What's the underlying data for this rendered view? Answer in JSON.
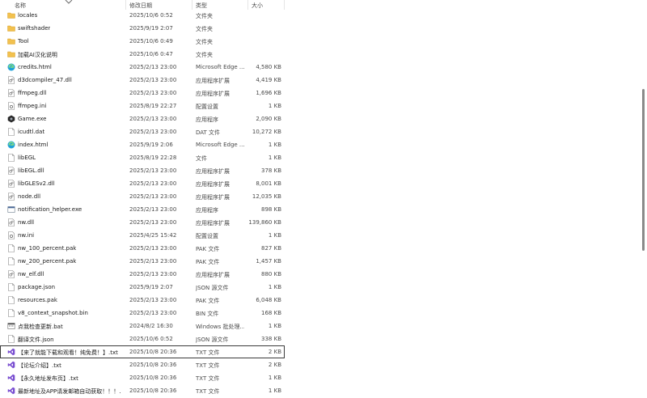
{
  "header": {
    "name": "名称",
    "date": "修改日期",
    "type": "类型",
    "size": "大小"
  },
  "files": [
    {
      "name": "locales",
      "date": "2025/10/6 0:52",
      "type": "文件夹",
      "size": "",
      "icon": "folder-icon"
    },
    {
      "name": "swiftshader",
      "date": "2025/9/19 2:07",
      "type": "文件夹",
      "size": "",
      "icon": "folder-icon"
    },
    {
      "name": "Tool",
      "date": "2025/10/6 0:49",
      "type": "文件夹",
      "size": "",
      "icon": "folder-icon"
    },
    {
      "name": "加载AI汉化说明",
      "date": "2025/10/6 0:47",
      "type": "文件夹",
      "size": "",
      "icon": "folder-icon"
    },
    {
      "name": "credits.html",
      "date": "2025/2/13 23:00",
      "type": "Microsoft Edge ...",
      "size": "4,580 KB",
      "icon": "edge-icon"
    },
    {
      "name": "d3dcompiler_47.dll",
      "date": "2025/2/13 23:00",
      "type": "应用程序扩展",
      "size": "4,419 KB",
      "icon": "dll-icon"
    },
    {
      "name": "ffmpeg.dll",
      "date": "2025/2/13 23:00",
      "type": "应用程序扩展",
      "size": "1,696 KB",
      "icon": "dll-icon"
    },
    {
      "name": "ffmpeg.ini",
      "date": "2025/8/19 22:27",
      "type": "配置设置",
      "size": "1 KB",
      "icon": "ini-icon"
    },
    {
      "name": "Game.exe",
      "date": "2025/2/13 23:00",
      "type": "应用程序",
      "size": "2,090 KB",
      "icon": "game-exe-icon"
    },
    {
      "name": "icudtl.dat",
      "date": "2025/2/13 23:00",
      "type": "DAT 文件",
      "size": "10,272 KB",
      "icon": "file-icon"
    },
    {
      "name": "index.html",
      "date": "2025/9/19 2:06",
      "type": "Microsoft Edge ...",
      "size": "1 KB",
      "icon": "edge-icon"
    },
    {
      "name": "libEGL",
      "date": "2025/8/19 22:28",
      "type": "文件",
      "size": "1 KB",
      "icon": "file-icon"
    },
    {
      "name": "libEGL.dll",
      "date": "2025/2/13 23:00",
      "type": "应用程序扩展",
      "size": "378 KB",
      "icon": "dll-icon"
    },
    {
      "name": "libGLESv2.dll",
      "date": "2025/2/13 23:00",
      "type": "应用程序扩展",
      "size": "8,001 KB",
      "icon": "dll-icon"
    },
    {
      "name": "node.dll",
      "date": "2025/2/13 23:00",
      "type": "应用程序扩展",
      "size": "12,035 KB",
      "icon": "dll-icon"
    },
    {
      "name": "notification_helper.exe",
      "date": "2025/2/13 23:00",
      "type": "应用程序",
      "size": "898 KB",
      "icon": "exe-icon"
    },
    {
      "name": "nw.dll",
      "date": "2025/2/13 23:00",
      "type": "应用程序扩展",
      "size": "139,860 KB",
      "icon": "dll-icon"
    },
    {
      "name": "nw.ini",
      "date": "2025/4/25 15:42",
      "type": "配置设置",
      "size": "1 KB",
      "icon": "ini-icon"
    },
    {
      "name": "nw_100_percent.pak",
      "date": "2025/2/13 23:00",
      "type": "PAK 文件",
      "size": "827 KB",
      "icon": "file-icon"
    },
    {
      "name": "nw_200_percent.pak",
      "date": "2025/2/13 23:00",
      "type": "PAK 文件",
      "size": "1,457 KB",
      "icon": "file-icon"
    },
    {
      "name": "nw_elf.dll",
      "date": "2025/2/13 23:00",
      "type": "应用程序扩展",
      "size": "880 KB",
      "icon": "dll-icon"
    },
    {
      "name": "package.json",
      "date": "2025/9/19 2:07",
      "type": "JSON 源文件",
      "size": "1 KB",
      "icon": "file-icon"
    },
    {
      "name": "resources.pak",
      "date": "2025/2/13 23:00",
      "type": "PAK 文件",
      "size": "6,048 KB",
      "icon": "file-icon"
    },
    {
      "name": "v8_context_snapshot.bin",
      "date": "2025/2/13 23:00",
      "type": "BIN 文件",
      "size": "168 KB",
      "icon": "file-icon"
    },
    {
      "name": "点我检查更新.bat",
      "date": "2024/8/2 16:30",
      "type": "Windows 批处理...",
      "size": "1 KB",
      "icon": "bat-icon"
    },
    {
      "name": "翻译文件.json",
      "date": "2025/10/6 0:52",
      "type": "JSON 源文件",
      "size": "338 KB",
      "icon": "file-icon"
    },
    {
      "name": "【来了就能下载和观看！纯免费！】.txt",
      "date": "2025/10/8 20:36",
      "type": "TXT 文件",
      "size": "2 KB",
      "icon": "vs-icon",
      "selected": true
    },
    {
      "name": "【论坛介绍】.txt",
      "date": "2025/10/8 20:36",
      "type": "TXT 文件",
      "size": "2 KB",
      "icon": "vs-icon"
    },
    {
      "name": "【永久地址发布页】.txt",
      "date": "2025/10/8 20:36",
      "type": "TXT 文件",
      "size": "1 KB",
      "icon": "vs-icon"
    },
    {
      "name": "最新地址及APP请发邮箱自动获取！！！...",
      "date": "2025/10/8 20:36",
      "type": "TXT 文件",
      "size": "1 KB",
      "icon": "vs-icon"
    }
  ],
  "colors": {
    "folder": "#f2c14e",
    "edge": "#1fa1d9",
    "vs": "#7a4fd1",
    "game": "#2a2a2a"
  }
}
